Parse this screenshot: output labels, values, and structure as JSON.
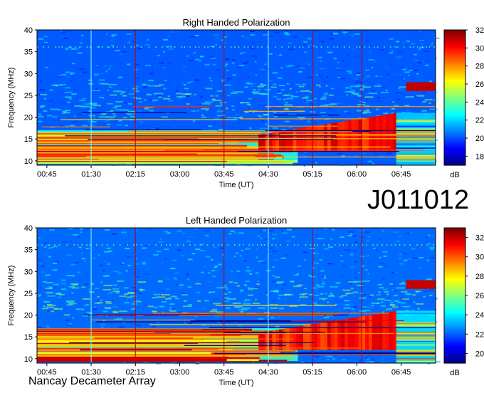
{
  "source_id": "J011012",
  "instrument": "Nancay Decameter Array",
  "colormap": [
    "#00007f",
    "#0000ff",
    "#007fff",
    "#00ffff",
    "#7fff7f",
    "#ffff00",
    "#ff7f00",
    "#ff0000",
    "#7f0000"
  ],
  "chart_data": [
    {
      "type": "heatmap",
      "title": "Right Handed Polarization",
      "xlabel": "Time (UT)",
      "ylabel": "Frequency (MHz)",
      "x_ticks": [
        "00:45",
        "01:30",
        "02:15",
        "03:00",
        "03:45",
        "04:30",
        "05:15",
        "06:00",
        "06:45"
      ],
      "x_tick_minutes": [
        45,
        90,
        135,
        180,
        225,
        270,
        315,
        360,
        405
      ],
      "xlim_minutes": [
        35,
        440
      ],
      "y_ticks": [
        10,
        15,
        20,
        25,
        30,
        35,
        40
      ],
      "ylim": [
        9,
        40
      ],
      "colorbar": {
        "label": "dB",
        "ticks": [
          18,
          20,
          22,
          24,
          26,
          28,
          30,
          32
        ],
        "range": [
          17,
          32
        ]
      },
      "emission_features": [
        {
          "kind": "band",
          "freq_mhz": [
            9.5,
            17
          ],
          "time_minutes": [
            35,
            300
          ],
          "level_db": 29
        },
        {
          "kind": "ramp",
          "freq_start_mhz": [
            12,
            16
          ],
          "freq_end_mhz": [
            12,
            21
          ],
          "time_minutes": [
            260,
            400
          ],
          "level_db": 31
        },
        {
          "kind": "patch",
          "freq_mhz": [
            26,
            28
          ],
          "time_minutes": [
            410,
            440
          ],
          "level_db": 31
        }
      ]
    },
    {
      "type": "heatmap",
      "title": "Left Handed Polarization",
      "xlabel": "Time (UT)",
      "ylabel": "Frequency (MHz)",
      "x_ticks": [
        "00:45",
        "01:30",
        "02:15",
        "03:00",
        "03:45",
        "04:30",
        "05:15",
        "06:00",
        "06:45"
      ],
      "x_tick_minutes": [
        45,
        90,
        135,
        180,
        225,
        270,
        315,
        360,
        405
      ],
      "xlim_minutes": [
        35,
        440
      ],
      "y_ticks": [
        10,
        15,
        20,
        25,
        30,
        35,
        40
      ],
      "ylim": [
        9,
        40
      ],
      "colorbar": {
        "label": "dB",
        "ticks": [
          20,
          22,
          24,
          26,
          28,
          30,
          32
        ],
        "range": [
          19,
          33
        ]
      },
      "emission_features": [
        {
          "kind": "band",
          "freq_mhz": [
            9.5,
            17
          ],
          "time_minutes": [
            35,
            300
          ],
          "level_db": 31
        },
        {
          "kind": "ramp",
          "freq_start_mhz": [
            12,
            16
          ],
          "freq_end_mhz": [
            12,
            21
          ],
          "time_minutes": [
            260,
            400
          ],
          "level_db": 32
        },
        {
          "kind": "patch",
          "freq_mhz": [
            26,
            28
          ],
          "time_minutes": [
            410,
            440
          ],
          "level_db": 32
        }
      ]
    }
  ]
}
